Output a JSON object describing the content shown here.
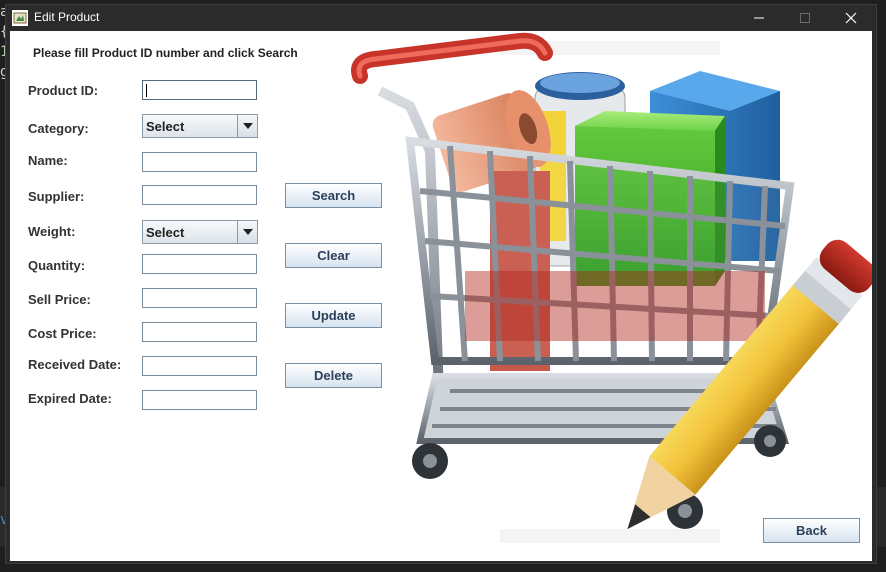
{
  "background": {
    "gutter_chars": [
      "a",
      "{",
      "1",
      "g"
    ],
    "bottom_char": "v"
  },
  "window": {
    "title": "Edit Product",
    "controls": {
      "minimize": "—",
      "maximize": "☐",
      "close": "✕"
    }
  },
  "form": {
    "instruction": "Please fill Product ID number and click Search",
    "fields": {
      "product_id": {
        "label": "Product ID:",
        "value": ""
      },
      "category": {
        "label": "Category:",
        "selected": "Select"
      },
      "name": {
        "label": "Name:",
        "value": ""
      },
      "supplier": {
        "label": "Supplier:",
        "value": ""
      },
      "weight": {
        "label": "Weight:",
        "selected": "Select"
      },
      "quantity": {
        "label": "Quantity:",
        "value": ""
      },
      "sell_price": {
        "label": "Sell Price:",
        "value": ""
      },
      "cost_price": {
        "label": "Cost Price:",
        "value": ""
      },
      "received_date": {
        "label": "Received Date:",
        "value": ""
      },
      "expired_date": {
        "label": "Expired Date:",
        "value": ""
      }
    }
  },
  "actions": {
    "search": "Search",
    "clear": "Clear",
    "update": "Update",
    "delete": "Delete",
    "back": "Back"
  },
  "illustration": {
    "icon": "shopping-cart-with-pencil-icon",
    "colors": {
      "handle": "#e0453a",
      "green_box": "#5cc43a",
      "blue_box": "#2f7bc4",
      "pencil": "#f2c23a",
      "roll": "#e89a78"
    }
  }
}
